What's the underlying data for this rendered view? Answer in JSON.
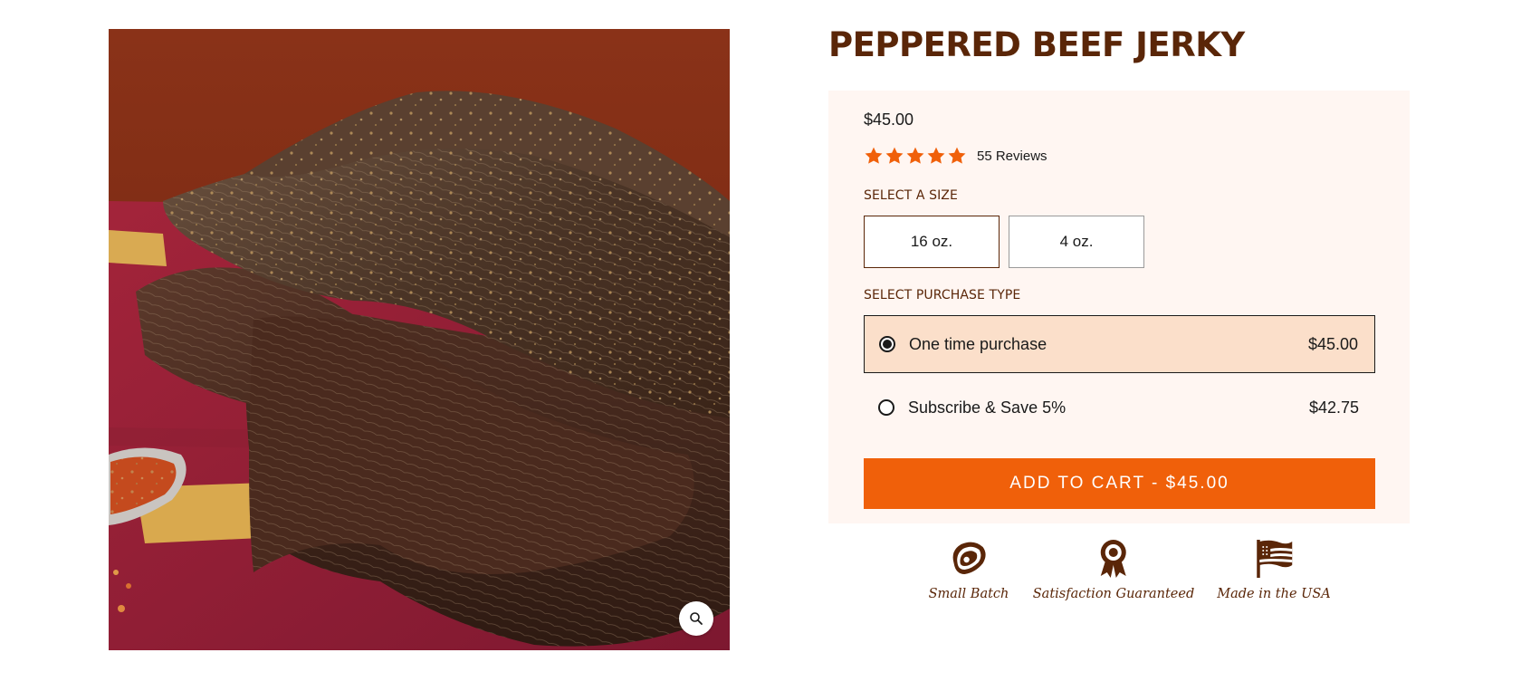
{
  "product": {
    "title": "PEPPERED BEEF JERKY",
    "price": "$45.00",
    "rating": 5,
    "rating_max": 5,
    "reviews_label": "55 Reviews"
  },
  "image": {
    "alt": "Peppered beef jerky",
    "zoom_icon": "magnifier-icon"
  },
  "size_selector": {
    "label": "SELECT A SIZE",
    "options": [
      {
        "label": "16 oz.",
        "selected": true
      },
      {
        "label": "4 oz.",
        "selected": false
      }
    ]
  },
  "purchase_type": {
    "label": "SELECT PURCHASE TYPE",
    "options": [
      {
        "label": "One time purchase",
        "price": "$45.00",
        "selected": true
      },
      {
        "label": "Subscribe & Save 5%",
        "price": "$42.75",
        "selected": false
      }
    ]
  },
  "cta": {
    "label": "ADD TO CART - $45.00"
  },
  "badges": [
    {
      "label": "Small Batch",
      "icon": "steak-icon"
    },
    {
      "label": "Satisfaction Guaranteed",
      "icon": "award-ribbon-icon"
    },
    {
      "label": "Made in the USA",
      "icon": "us-flag-icon"
    }
  ],
  "colors": {
    "brand_brown": "#5a2608",
    "accent_orange": "#f0600a",
    "star_orange": "#f0600a",
    "panel_background": "#fff6f2",
    "selected_option_background": "#fbdfca"
  }
}
